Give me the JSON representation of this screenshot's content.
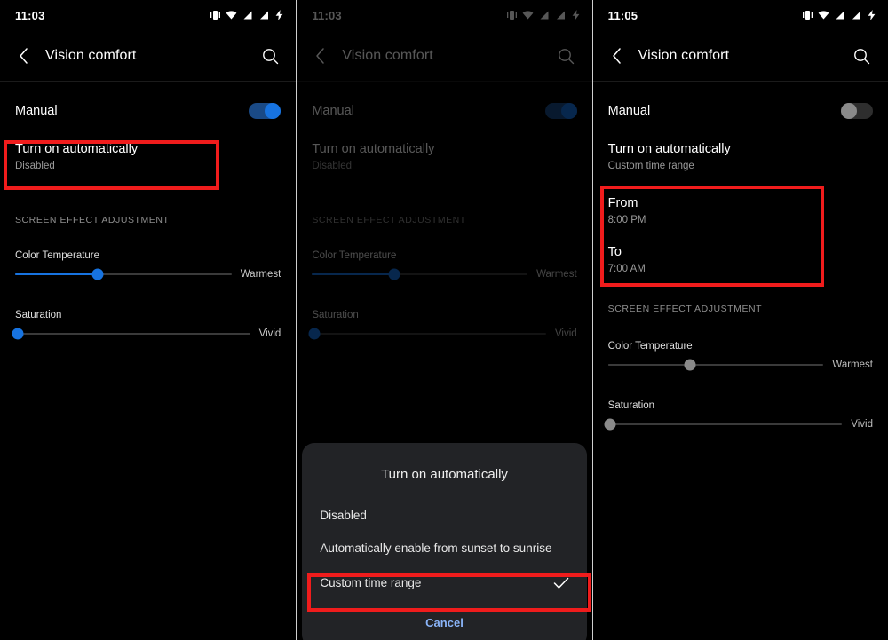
{
  "panels": [
    {
      "id": "panel-initial",
      "statusbar": {
        "time": "11:03",
        "icons": [
          "vibrate-icon",
          "wifi-icon",
          "signal-icon",
          "signal-alt-icon",
          "charging-bolt-icon"
        ]
      },
      "appbar": {
        "back_icon": "chevron-left-icon",
        "title": "Vision comfort",
        "search_icon": "search-icon"
      },
      "manual": {
        "label": "Manual",
        "state": "on"
      },
      "turn_on_automatically": {
        "title": "Turn on automatically",
        "value": "Disabled"
      },
      "section_header": "SCREEN EFFECT ADJUSTMENT",
      "sliders": [
        {
          "label": "Color Temperature",
          "end_label": "Warmest",
          "percent": 38,
          "enabled": true
        },
        {
          "label": "Saturation",
          "end_label": "Vivid",
          "percent": 0,
          "enabled": true
        }
      ],
      "dimmed": false,
      "highlight": "turn-on-automatically-row"
    },
    {
      "id": "panel-dialog",
      "statusbar": {
        "time": "11:03",
        "icons": [
          "vibrate-icon",
          "wifi-icon",
          "signal-icon",
          "signal-alt-icon",
          "charging-bolt-icon"
        ]
      },
      "appbar": {
        "back_icon": "chevron-left-icon",
        "title": "Vision comfort",
        "search_icon": "search-icon"
      },
      "manual": {
        "label": "Manual",
        "state": "on"
      },
      "turn_on_automatically": {
        "title": "Turn on automatically",
        "value": "Disabled"
      },
      "section_header": "SCREEN EFFECT ADJUSTMENT",
      "sliders": [
        {
          "label": "Color Temperature",
          "end_label": "Warmest",
          "percent": 38,
          "enabled": true
        },
        {
          "label": "Saturation",
          "end_label": "Vivid",
          "percent": 0,
          "enabled": true
        }
      ],
      "dimmed": true,
      "dialog": {
        "title": "Turn on automatically",
        "options": [
          {
            "label": "Disabled",
            "selected": false
          },
          {
            "label": "Automatically enable from sunset to sunrise",
            "selected": false
          },
          {
            "label": "Custom time range",
            "selected": true,
            "check_icon": "checkmark-icon"
          }
        ],
        "cancel_label": "Cancel"
      },
      "highlight": "custom-time-range-option"
    },
    {
      "id": "panel-custom-range",
      "statusbar": {
        "time": "11:05",
        "icons": [
          "vibrate-icon",
          "wifi-icon",
          "signal-icon",
          "signal-alt-icon",
          "charging-bolt-icon"
        ]
      },
      "appbar": {
        "back_icon": "chevron-left-icon",
        "title": "Vision comfort",
        "search_icon": "search-icon"
      },
      "manual": {
        "label": "Manual",
        "state": "off"
      },
      "turn_on_automatically": {
        "title": "Turn on automatically",
        "value": "Custom time range"
      },
      "time_range": {
        "from": {
          "title": "From",
          "value": "8:00 PM"
        },
        "to": {
          "title": "To",
          "value": "7:00 AM"
        }
      },
      "section_header": "SCREEN EFFECT ADJUSTMENT",
      "sliders": [
        {
          "label": "Color Temperature",
          "end_label": "Warmest",
          "percent": 38,
          "enabled": false
        },
        {
          "label": "Saturation",
          "end_label": "Vivid",
          "percent": 0,
          "enabled": false
        }
      ],
      "dimmed": false,
      "highlight": "time-range-box"
    }
  ],
  "colors": {
    "highlight_red": "#f01c1c",
    "accent_blue": "#1773e0",
    "cancel_blue": "#8ab4f8",
    "background": "#000000",
    "dialog_background": "#222326"
  }
}
